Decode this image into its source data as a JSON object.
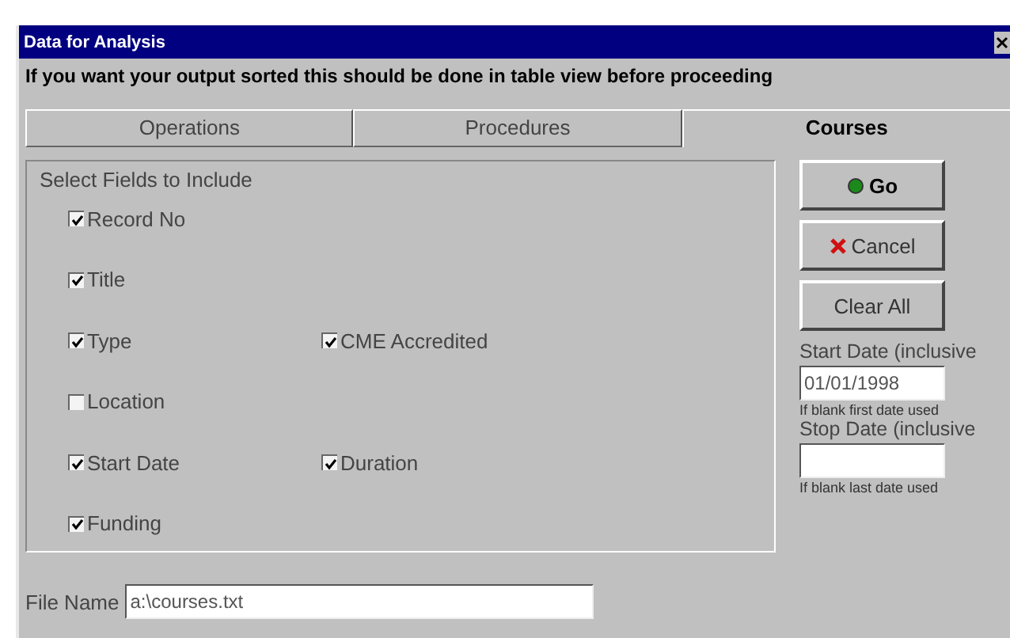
{
  "window": {
    "title": "Data for Analysis"
  },
  "notice": "If you want your output sorted this should be done in table view before proceeding",
  "tabs": [
    {
      "label": "Operations",
      "selected": false
    },
    {
      "label": "Procedures",
      "selected": false
    },
    {
      "label": "Courses",
      "selected": true
    }
  ],
  "fields_group": {
    "title": "Select Fields to Include",
    "rows": [
      [
        {
          "label": "Record No",
          "checked": true
        }
      ],
      [
        {
          "label": "Title",
          "checked": true
        }
      ],
      [
        {
          "label": "Type",
          "checked": true
        },
        {
          "label": "CME Accredited",
          "checked": true
        }
      ],
      [
        {
          "label": "Location",
          "checked": false
        }
      ],
      [
        {
          "label": "Start Date",
          "checked": true
        },
        {
          "label": "Duration",
          "checked": true
        }
      ],
      [
        {
          "label": "Funding",
          "checked": true
        }
      ]
    ]
  },
  "buttons": [
    {
      "label": "Go",
      "kind": "go"
    },
    {
      "label": "Cancel",
      "kind": "cancel"
    },
    {
      "label": "Clear All",
      "kind": "plain"
    }
  ],
  "start_date": {
    "label": "Start Date (inclusive",
    "value": "01/01/1998",
    "hint": "If blank first date used"
  },
  "stop_date": {
    "label": "Stop Date (inclusive",
    "hint": "If blank last date used"
  },
  "file_name": {
    "label": "File Name",
    "value": "a:\\courses.txt"
  }
}
